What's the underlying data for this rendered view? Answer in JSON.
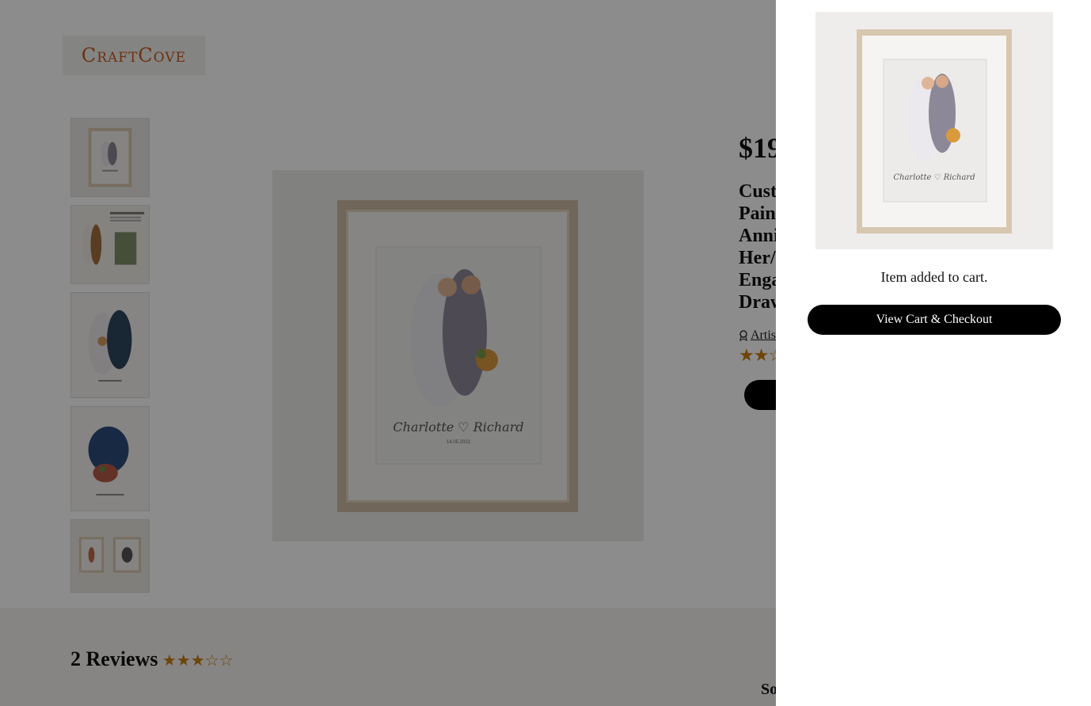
{
  "brand": {
    "name": "CraftCove",
    "accent": "#c65a1e"
  },
  "product": {
    "price": "$19",
    "title_lines": [
      "Cust",
      "Pain",
      "Anni",
      "Her/",
      "Enga",
      "Draw"
    ],
    "artist_label": "Artist",
    "rating_stars": "★★☆"
  },
  "reviews": {
    "heading": "2 Reviews",
    "stars": "★★★☆☆",
    "sort_label": "So"
  },
  "painting": {
    "names": "Charlotte ♡ Richard",
    "date": "14.05.2022"
  },
  "cart_drawer": {
    "message": "Item added to cart.",
    "checkout_label": "View Cart & Checkout"
  },
  "colors": {
    "star": "#c77f10",
    "button": "#000000",
    "overlay": "rgba(0,0,0,0.45)"
  }
}
